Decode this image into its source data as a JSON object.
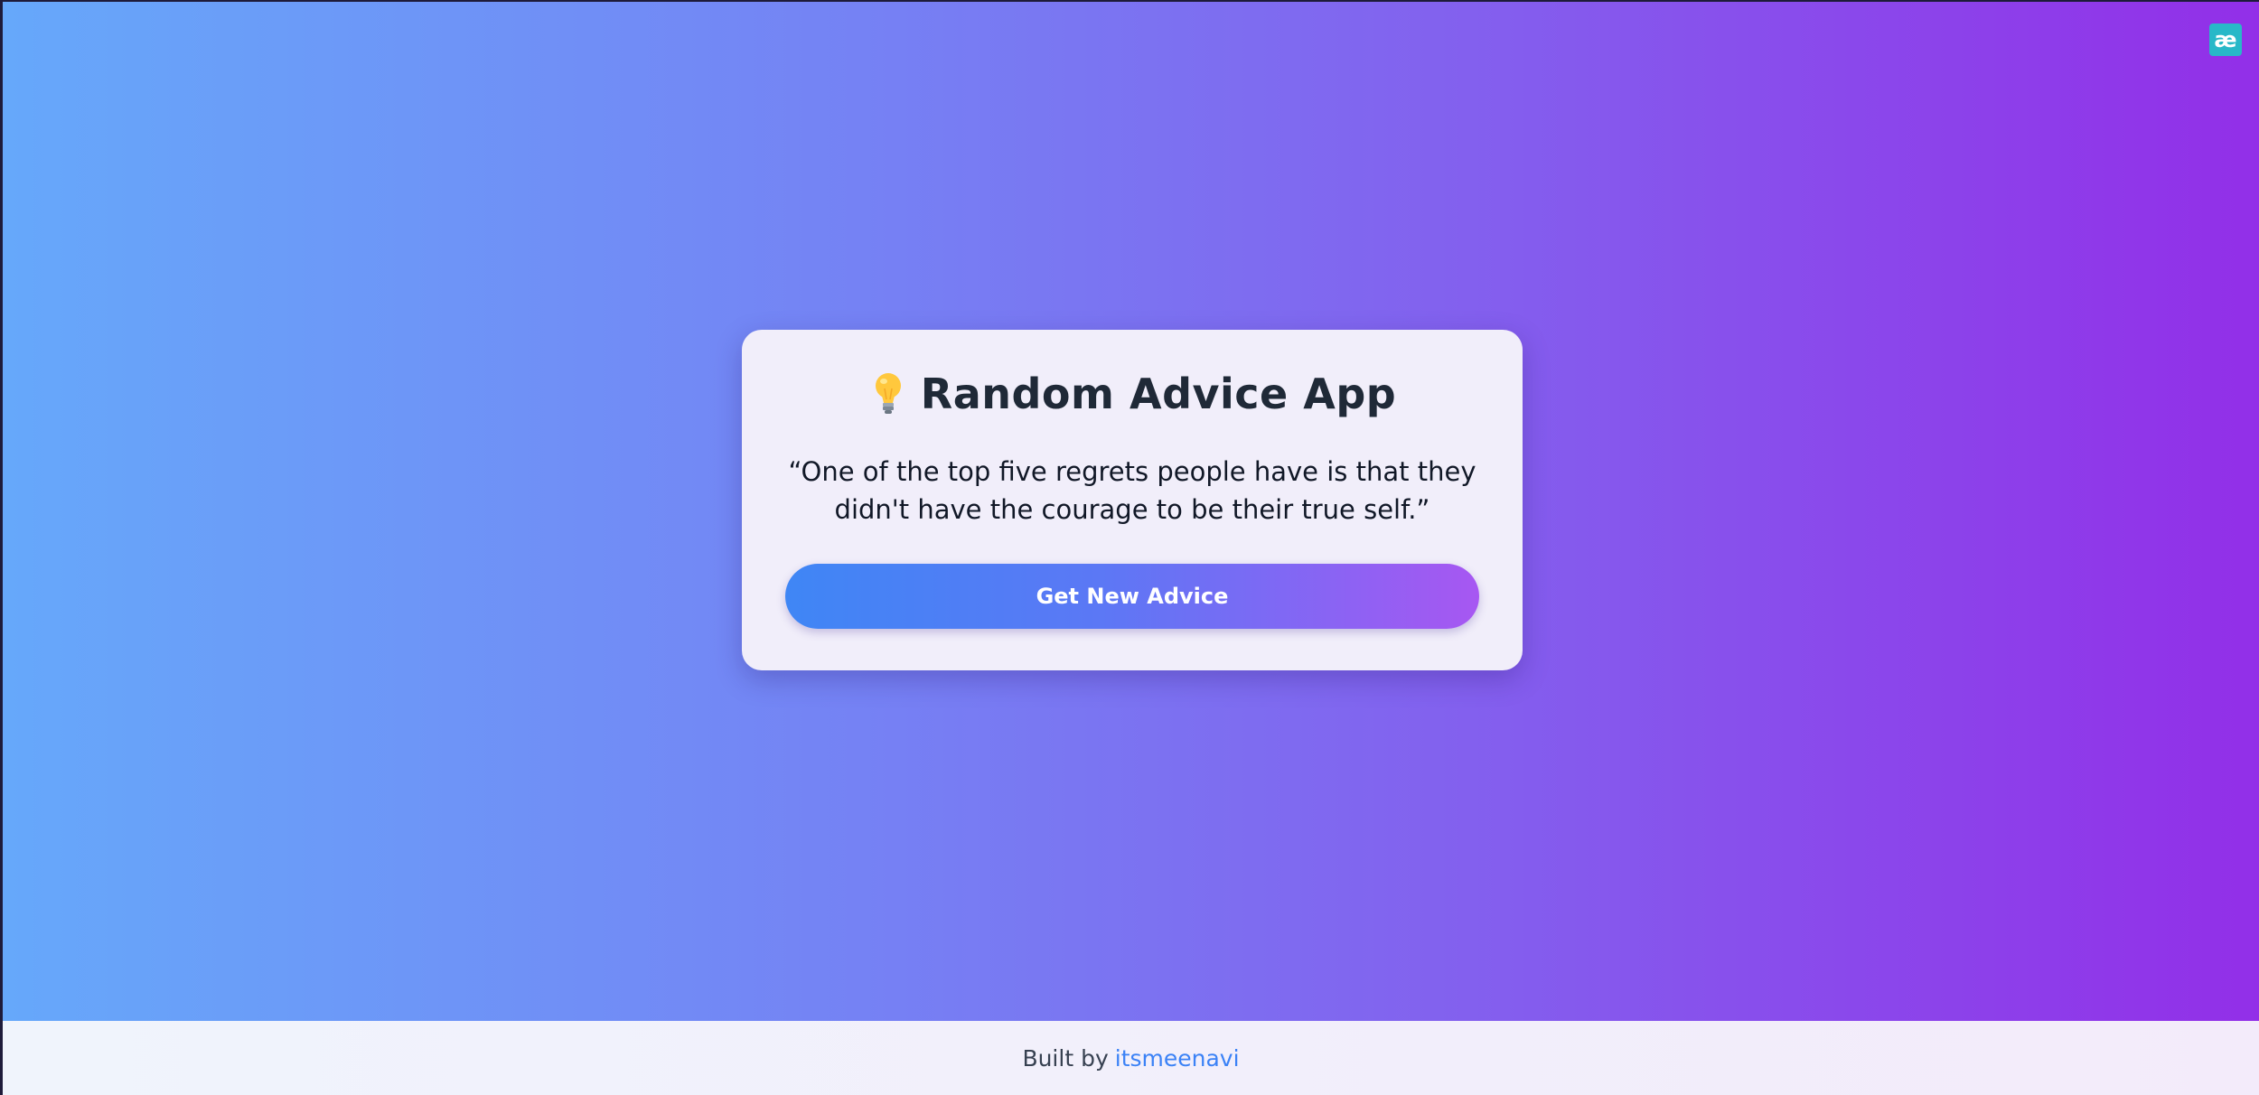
{
  "app": {
    "title": "Random Advice App",
    "icon": "lightbulb-icon"
  },
  "advice": {
    "quote": "“One of the top five regrets people have is that they didn't have the courage to be their true self.”"
  },
  "button": {
    "label": "Get New Advice"
  },
  "footer": {
    "prefix": "Built by",
    "author": "itsmeenavi"
  },
  "corner_badge": {
    "icon": "ae-extension-icon",
    "glyph": "æ"
  },
  "colors": {
    "accent_blue": "#3b82f6",
    "accent_purple": "#a855f7",
    "bg_gradient_start": "#66a8fa",
    "bg_gradient_end": "#922fe8"
  }
}
